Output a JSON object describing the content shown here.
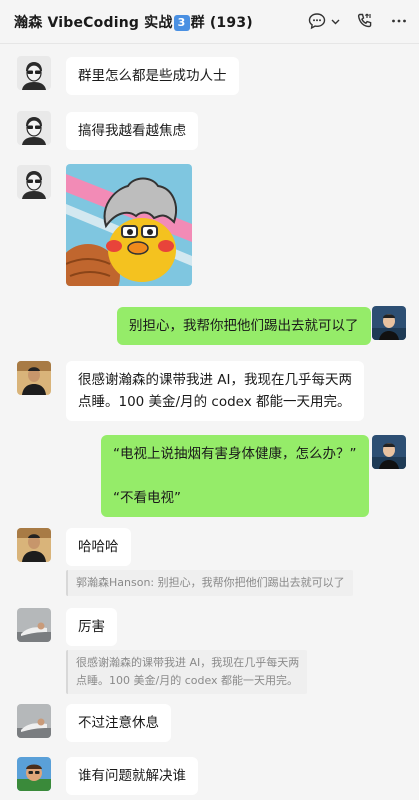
{
  "header": {
    "title_pre": "瀚森 VibeCoding 实战",
    "title_num": "3",
    "title_post": "群 (193)",
    "icons": [
      "chat-bubble-icon",
      "chevron-down-icon",
      "phone-icon",
      "more-icon"
    ]
  },
  "messages": [
    {
      "text": "群里怎么都是些成功人士"
    },
    {
      "text": "搞得我越看越焦虑"
    },
    {
      "sticker": "duck-sticker"
    },
    {
      "text": "别担心，我帮你把他们踢出去就可以了"
    },
    {
      "text": "很感谢瀚森的课带我进 AI，我现在几乎每天两\n点睡。100 美金/月的 codex 都能一天用完。"
    },
    {
      "text": "“电视上说抽烟有害身体健康，怎么办？”\n\n“不看电视”"
    },
    {
      "text": "哈哈哈",
      "quote": "郭瀚森Hanson: 别担心，我帮你把他们踢出去就可以了"
    },
    {
      "text": "厉害",
      "quote": "很感谢瀚森的课带我进 AI，我现在几乎每天两\n点睡。100 美金/月的 codex 都能一天用完。"
    },
    {
      "text": "不过注意休息"
    },
    {
      "text": "谁有问题就解决谁"
    }
  ]
}
